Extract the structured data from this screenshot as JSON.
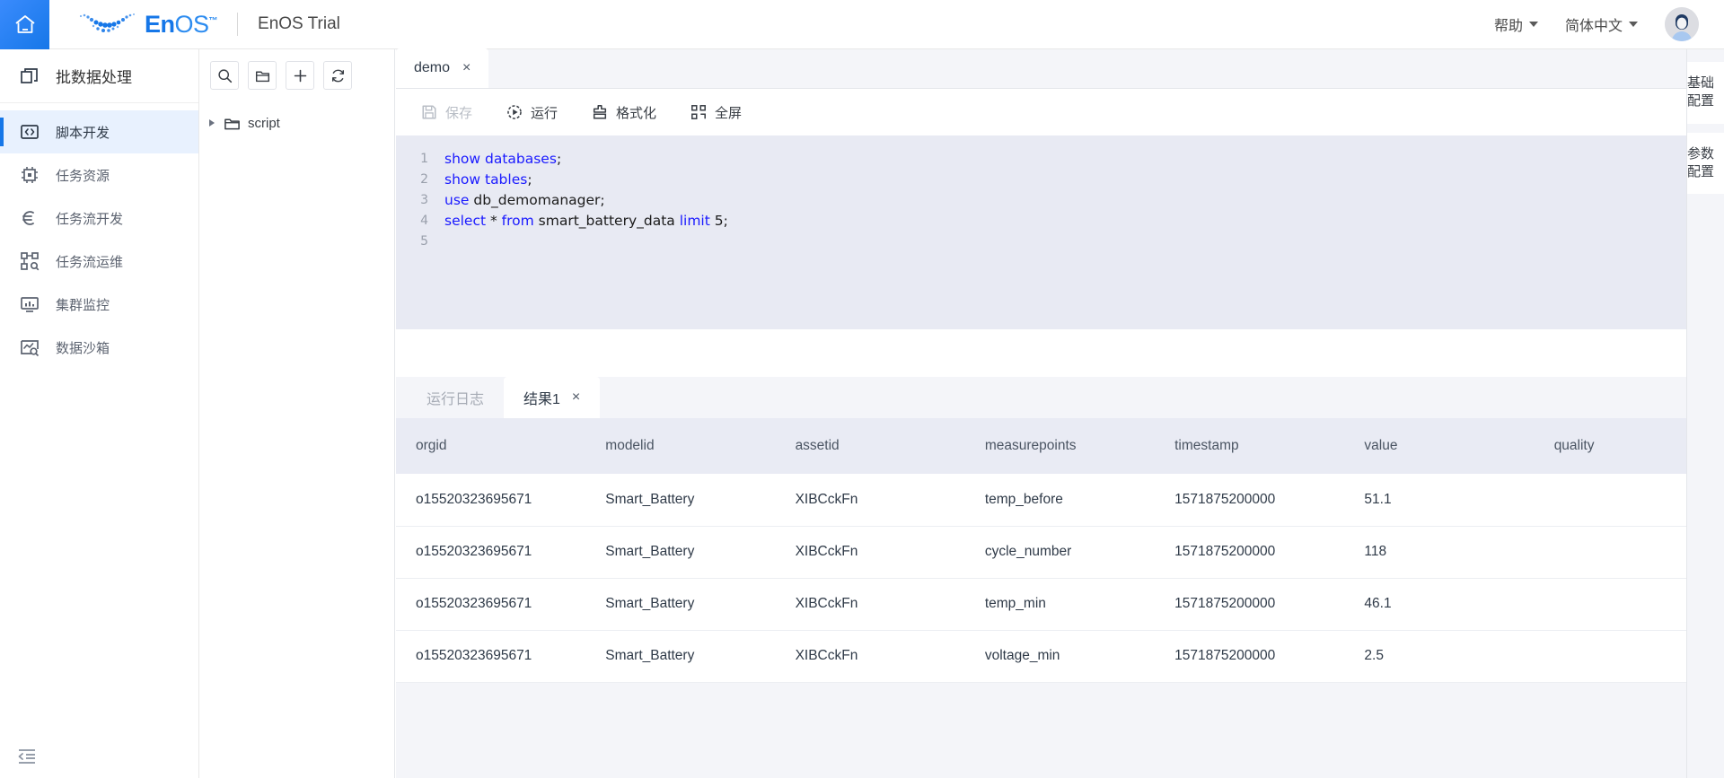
{
  "header": {
    "home_icon": "home-icon",
    "logo_en": "En",
    "logo_os": "OS",
    "logo_tm": "™",
    "app_title": "EnOS Trial",
    "help_label": "帮助",
    "lang_label": "简体中文",
    "avatar": "user-avatar"
  },
  "sidebar": {
    "module_title": "批数据处理",
    "module_icon": "copy-stack-icon",
    "collapse_icon": "collapse-sidebar-icon",
    "items": [
      {
        "label": "脚本开发",
        "icon": "code-brackets-icon",
        "active": true
      },
      {
        "label": "任务资源",
        "icon": "chip-icon",
        "active": false
      },
      {
        "label": "任务流开发",
        "icon": "flow-branch-icon",
        "active": false
      },
      {
        "label": "任务流运维",
        "icon": "nodes-graph-icon",
        "active": false
      },
      {
        "label": "集群监控",
        "icon": "monitor-chart-icon",
        "active": false
      },
      {
        "label": "数据沙箱",
        "icon": "sandbox-search-icon",
        "active": false
      }
    ]
  },
  "file_panel": {
    "buttons": [
      {
        "name": "search-icon",
        "title": "搜索"
      },
      {
        "name": "new-folder-icon",
        "title": "新建文件夹"
      },
      {
        "name": "plus-icon",
        "title": "新建"
      },
      {
        "name": "refresh-icon",
        "title": "刷新"
      }
    ],
    "tree": [
      {
        "name": "script",
        "icon": "folder-icon",
        "expanded": false
      }
    ]
  },
  "editor": {
    "tabs": [
      {
        "label": "demo",
        "close": "×",
        "active": true
      }
    ],
    "toolbar": [
      {
        "label": "保存",
        "icon": "save-icon",
        "disabled": true
      },
      {
        "label": "运行",
        "icon": "play-icon",
        "disabled": false
      },
      {
        "label": "格式化",
        "icon": "format-icon",
        "disabled": false
      },
      {
        "label": "全屏",
        "icon": "fullscreen-icon",
        "disabled": false
      }
    ],
    "code_lines": [
      {
        "num": "1",
        "tokens": [
          {
            "t": "show databases",
            "k": true
          },
          {
            "t": ";",
            "k": false
          }
        ]
      },
      {
        "num": "2",
        "tokens": [
          {
            "t": "show tables",
            "k": true
          },
          {
            "t": ";",
            "k": false
          }
        ]
      },
      {
        "num": "3",
        "tokens": [
          {
            "t": "use",
            "k": true
          },
          {
            "t": " db_demomanager;",
            "k": false
          }
        ]
      },
      {
        "num": "4",
        "tokens": [
          {
            "t": "select",
            "k": true
          },
          {
            "t": " * ",
            "k": false
          },
          {
            "t": "from",
            "k": true
          },
          {
            "t": " smart_battery_data ",
            "k": false
          },
          {
            "t": "limit",
            "k": true
          },
          {
            "t": " 5;",
            "k": false
          }
        ]
      },
      {
        "num": "5",
        "tokens": []
      }
    ]
  },
  "results": {
    "tabs": [
      {
        "label": "运行日志",
        "active": false,
        "closable": false
      },
      {
        "label": "结果1",
        "active": true,
        "closable": true,
        "close": "×"
      }
    ],
    "columns": [
      "orgid",
      "modelid",
      "assetid",
      "measurepoints",
      "timestamp",
      "value",
      "quality"
    ],
    "rows": [
      [
        "o15520323695671",
        "Smart_Battery",
        "XIBCckFn",
        "temp_before",
        "1571875200000",
        "51.1",
        ""
      ],
      [
        "o15520323695671",
        "Smart_Battery",
        "XIBCckFn",
        "cycle_number",
        "1571875200000",
        "118",
        ""
      ],
      [
        "o15520323695671",
        "Smart_Battery",
        "XIBCckFn",
        "temp_min",
        "1571875200000",
        "46.1",
        ""
      ],
      [
        "o15520323695671",
        "Smart_Battery",
        "XIBCckFn",
        "voltage_min",
        "1571875200000",
        "2.5",
        ""
      ]
    ]
  },
  "right_rail": {
    "tabs": [
      {
        "label": "基础配置"
      },
      {
        "label": "参数配置"
      }
    ]
  },
  "colors": {
    "brand_blue": "#1677e8",
    "active_bg": "#e8f1fe",
    "code_bg": "#e8eaf3",
    "keyword_blue": "#1a1aff",
    "panel_bg": "#f4f5f9"
  }
}
